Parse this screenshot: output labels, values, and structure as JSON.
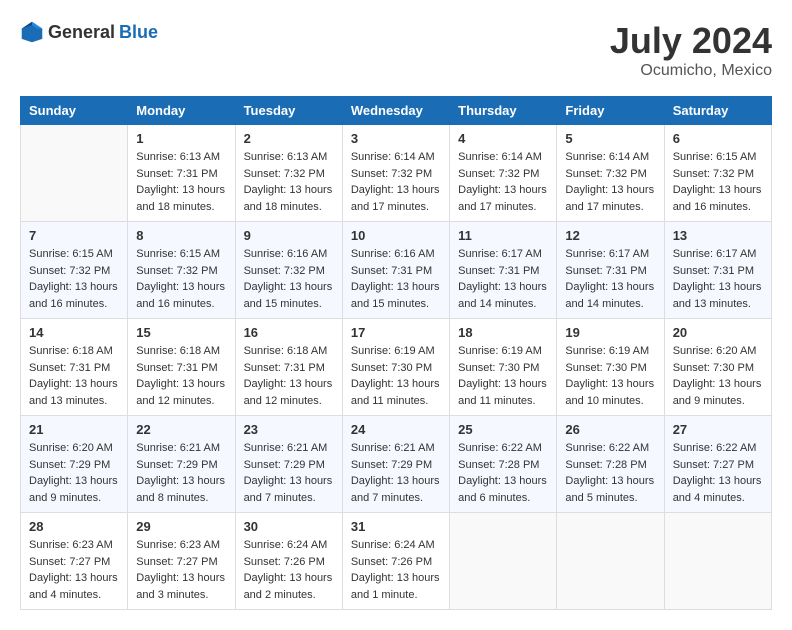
{
  "header": {
    "logo_general": "General",
    "logo_blue": "Blue",
    "month_year": "July 2024",
    "location": "Ocumicho, Mexico"
  },
  "weekdays": [
    "Sunday",
    "Monday",
    "Tuesday",
    "Wednesday",
    "Thursday",
    "Friday",
    "Saturday"
  ],
  "weeks": [
    [
      {
        "day": "",
        "sunrise": "",
        "sunset": "",
        "daylight": ""
      },
      {
        "day": "1",
        "sunrise": "Sunrise: 6:13 AM",
        "sunset": "Sunset: 7:31 PM",
        "daylight": "Daylight: 13 hours and 18 minutes."
      },
      {
        "day": "2",
        "sunrise": "Sunrise: 6:13 AM",
        "sunset": "Sunset: 7:32 PM",
        "daylight": "Daylight: 13 hours and 18 minutes."
      },
      {
        "day": "3",
        "sunrise": "Sunrise: 6:14 AM",
        "sunset": "Sunset: 7:32 PM",
        "daylight": "Daylight: 13 hours and 17 minutes."
      },
      {
        "day": "4",
        "sunrise": "Sunrise: 6:14 AM",
        "sunset": "Sunset: 7:32 PM",
        "daylight": "Daylight: 13 hours and 17 minutes."
      },
      {
        "day": "5",
        "sunrise": "Sunrise: 6:14 AM",
        "sunset": "Sunset: 7:32 PM",
        "daylight": "Daylight: 13 hours and 17 minutes."
      },
      {
        "day": "6",
        "sunrise": "Sunrise: 6:15 AM",
        "sunset": "Sunset: 7:32 PM",
        "daylight": "Daylight: 13 hours and 16 minutes."
      }
    ],
    [
      {
        "day": "7",
        "sunrise": "Sunrise: 6:15 AM",
        "sunset": "Sunset: 7:32 PM",
        "daylight": "Daylight: 13 hours and 16 minutes."
      },
      {
        "day": "8",
        "sunrise": "Sunrise: 6:15 AM",
        "sunset": "Sunset: 7:32 PM",
        "daylight": "Daylight: 13 hours and 16 minutes."
      },
      {
        "day": "9",
        "sunrise": "Sunrise: 6:16 AM",
        "sunset": "Sunset: 7:32 PM",
        "daylight": "Daylight: 13 hours and 15 minutes."
      },
      {
        "day": "10",
        "sunrise": "Sunrise: 6:16 AM",
        "sunset": "Sunset: 7:31 PM",
        "daylight": "Daylight: 13 hours and 15 minutes."
      },
      {
        "day": "11",
        "sunrise": "Sunrise: 6:17 AM",
        "sunset": "Sunset: 7:31 PM",
        "daylight": "Daylight: 13 hours and 14 minutes."
      },
      {
        "day": "12",
        "sunrise": "Sunrise: 6:17 AM",
        "sunset": "Sunset: 7:31 PM",
        "daylight": "Daylight: 13 hours and 14 minutes."
      },
      {
        "day": "13",
        "sunrise": "Sunrise: 6:17 AM",
        "sunset": "Sunset: 7:31 PM",
        "daylight": "Daylight: 13 hours and 13 minutes."
      }
    ],
    [
      {
        "day": "14",
        "sunrise": "Sunrise: 6:18 AM",
        "sunset": "Sunset: 7:31 PM",
        "daylight": "Daylight: 13 hours and 13 minutes."
      },
      {
        "day": "15",
        "sunrise": "Sunrise: 6:18 AM",
        "sunset": "Sunset: 7:31 PM",
        "daylight": "Daylight: 13 hours and 12 minutes."
      },
      {
        "day": "16",
        "sunrise": "Sunrise: 6:18 AM",
        "sunset": "Sunset: 7:31 PM",
        "daylight": "Daylight: 13 hours and 12 minutes."
      },
      {
        "day": "17",
        "sunrise": "Sunrise: 6:19 AM",
        "sunset": "Sunset: 7:30 PM",
        "daylight": "Daylight: 13 hours and 11 minutes."
      },
      {
        "day": "18",
        "sunrise": "Sunrise: 6:19 AM",
        "sunset": "Sunset: 7:30 PM",
        "daylight": "Daylight: 13 hours and 11 minutes."
      },
      {
        "day": "19",
        "sunrise": "Sunrise: 6:19 AM",
        "sunset": "Sunset: 7:30 PM",
        "daylight": "Daylight: 13 hours and 10 minutes."
      },
      {
        "day": "20",
        "sunrise": "Sunrise: 6:20 AM",
        "sunset": "Sunset: 7:30 PM",
        "daylight": "Daylight: 13 hours and 9 minutes."
      }
    ],
    [
      {
        "day": "21",
        "sunrise": "Sunrise: 6:20 AM",
        "sunset": "Sunset: 7:29 PM",
        "daylight": "Daylight: 13 hours and 9 minutes."
      },
      {
        "day": "22",
        "sunrise": "Sunrise: 6:21 AM",
        "sunset": "Sunset: 7:29 PM",
        "daylight": "Daylight: 13 hours and 8 minutes."
      },
      {
        "day": "23",
        "sunrise": "Sunrise: 6:21 AM",
        "sunset": "Sunset: 7:29 PM",
        "daylight": "Daylight: 13 hours and 7 minutes."
      },
      {
        "day": "24",
        "sunrise": "Sunrise: 6:21 AM",
        "sunset": "Sunset: 7:29 PM",
        "daylight": "Daylight: 13 hours and 7 minutes."
      },
      {
        "day": "25",
        "sunrise": "Sunrise: 6:22 AM",
        "sunset": "Sunset: 7:28 PM",
        "daylight": "Daylight: 13 hours and 6 minutes."
      },
      {
        "day": "26",
        "sunrise": "Sunrise: 6:22 AM",
        "sunset": "Sunset: 7:28 PM",
        "daylight": "Daylight: 13 hours and 5 minutes."
      },
      {
        "day": "27",
        "sunrise": "Sunrise: 6:22 AM",
        "sunset": "Sunset: 7:27 PM",
        "daylight": "Daylight: 13 hours and 4 minutes."
      }
    ],
    [
      {
        "day": "28",
        "sunrise": "Sunrise: 6:23 AM",
        "sunset": "Sunset: 7:27 PM",
        "daylight": "Daylight: 13 hours and 4 minutes."
      },
      {
        "day": "29",
        "sunrise": "Sunrise: 6:23 AM",
        "sunset": "Sunset: 7:27 PM",
        "daylight": "Daylight: 13 hours and 3 minutes."
      },
      {
        "day": "30",
        "sunrise": "Sunrise: 6:24 AM",
        "sunset": "Sunset: 7:26 PM",
        "daylight": "Daylight: 13 hours and 2 minutes."
      },
      {
        "day": "31",
        "sunrise": "Sunrise: 6:24 AM",
        "sunset": "Sunset: 7:26 PM",
        "daylight": "Daylight: 13 hours and 1 minute."
      },
      {
        "day": "",
        "sunrise": "",
        "sunset": "",
        "daylight": ""
      },
      {
        "day": "",
        "sunrise": "",
        "sunset": "",
        "daylight": ""
      },
      {
        "day": "",
        "sunrise": "",
        "sunset": "",
        "daylight": ""
      }
    ]
  ]
}
